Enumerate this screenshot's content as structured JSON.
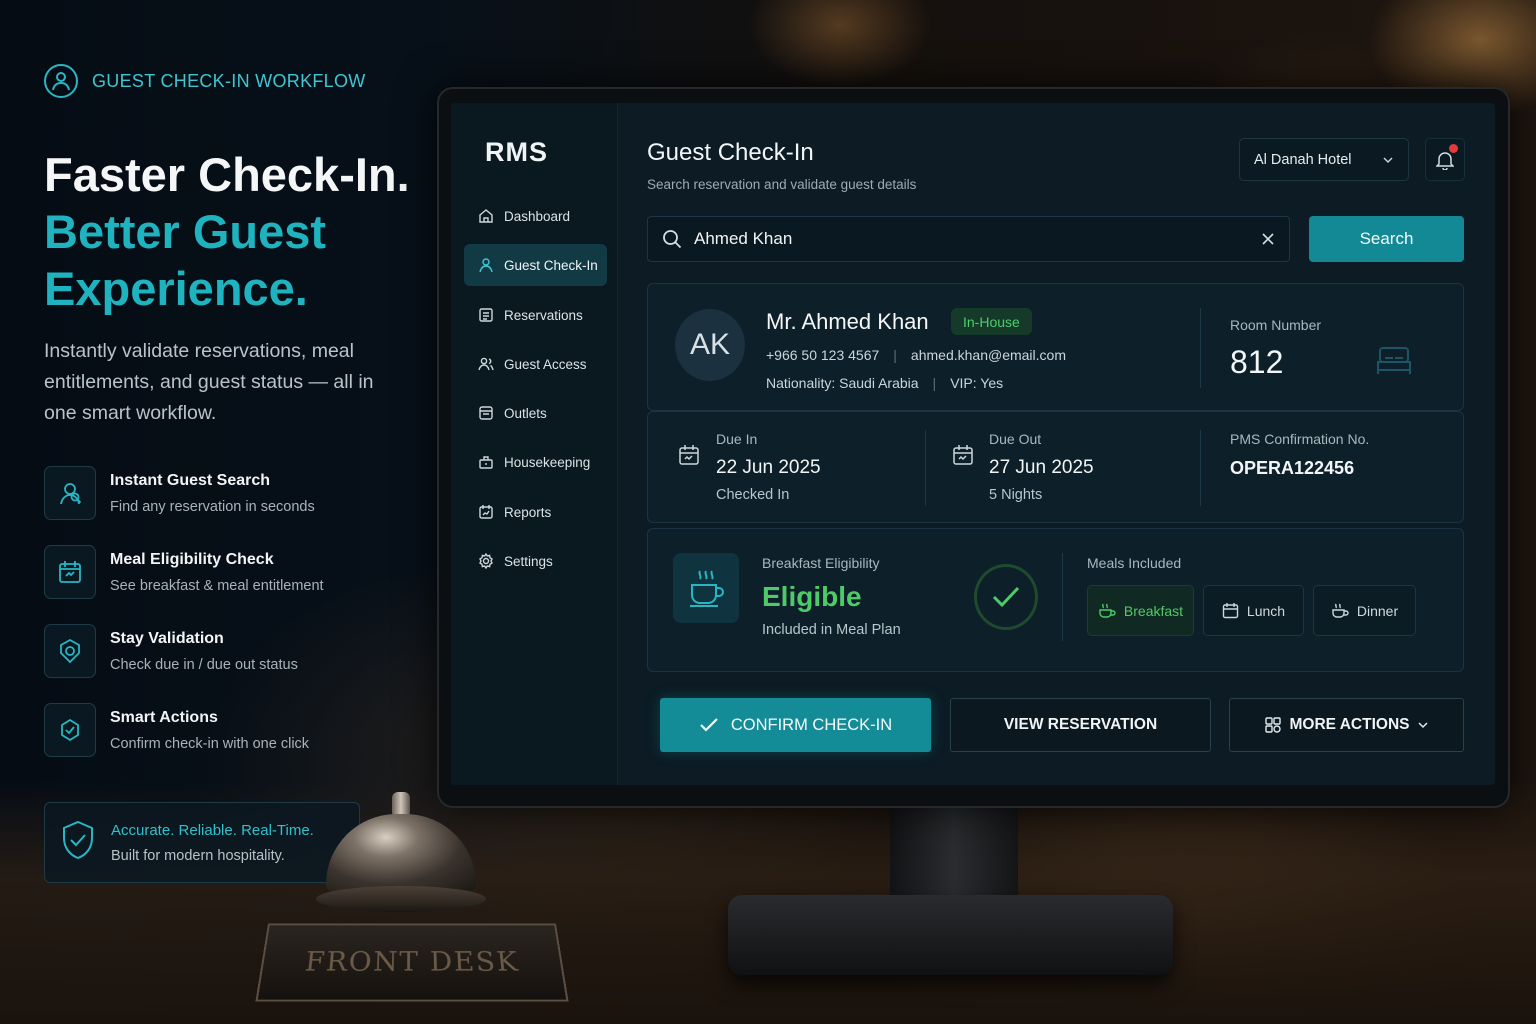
{
  "marketing": {
    "tag": "GUEST CHECK-IN WORKFLOW",
    "headline_1": "Faster Check-In.",
    "headline_2": "Better Guest Experience.",
    "description": "Instantly validate reservations, meal entitlements, and guest status — all in one smart workflow.",
    "features": [
      {
        "title": "Instant Guest Search",
        "subtitle": "Find any reservation in seconds",
        "icon": "guest-search-icon"
      },
      {
        "title": "Meal Eligibility Check",
        "subtitle": "See breakfast & meal entitlement",
        "icon": "calendar-icon"
      },
      {
        "title": "Stay Validation",
        "subtitle": "Check due in / due out status",
        "icon": "validation-icon"
      },
      {
        "title": "Smart Actions",
        "subtitle": "Confirm check-in with one click",
        "icon": "smart-action-icon"
      }
    ],
    "note_title": "Accurate. Reliable. Real-Time.",
    "note_subtitle": "Built for modern hospitality."
  },
  "plaque": "FRONT DESK",
  "app": {
    "logo": "RMS",
    "nav": [
      {
        "label": "Dashboard",
        "icon": "home-icon",
        "active": false
      },
      {
        "label": "Guest Check-In",
        "icon": "user-icon",
        "active": true
      },
      {
        "label": "Reservations",
        "icon": "list-icon",
        "active": false
      },
      {
        "label": "Guest Access",
        "icon": "users-icon",
        "active": false
      },
      {
        "label": "Outlets",
        "icon": "store-icon",
        "active": false
      },
      {
        "label": "Housekeeping",
        "icon": "housekeeping-icon",
        "active": false
      },
      {
        "label": "Reports",
        "icon": "report-icon",
        "active": false
      },
      {
        "label": "Settings",
        "icon": "gear-icon",
        "active": false
      }
    ],
    "page_title": "Guest Check-In",
    "page_subtitle": "Search reservation and validate guest details",
    "hotel_select": "Al Danah Hotel",
    "search_value": "Ahmed Khan",
    "search_button": "Search",
    "guest": {
      "initials": "AK",
      "name": "Mr. Ahmed Khan",
      "status": "In-House",
      "phone": "+966 50 123 4567",
      "email": "ahmed.khan@email.com",
      "nationality": "Nationality: Saudi Arabia",
      "vip": "VIP: Yes",
      "room_label": "Room Number",
      "room_number": "812"
    },
    "stay": {
      "due_in_label": "Due In",
      "due_in_date": "22 Jun 2025",
      "due_in_status": "Checked In",
      "due_out_label": "Due Out",
      "due_out_date": "27 Jun 2025",
      "nights": "5 Nights",
      "pms_label": "PMS Confirmation No.",
      "pms_number": "OPERA122456"
    },
    "meal": {
      "label": "Breakfast Eligibility",
      "status": "Eligible",
      "note": "Included in Meal Plan",
      "meals_label": "Meals Included",
      "meals": [
        "Breakfast",
        "Lunch",
        "Dinner"
      ]
    },
    "actions": {
      "confirm": "CONFIRM CHECK-IN",
      "view": "VIEW RESERVATION",
      "more": "MORE ACTIONS"
    }
  },
  "colors": {
    "accent": "#148c98",
    "eligible": "#4ecb67",
    "alert": "#e33b3b"
  }
}
